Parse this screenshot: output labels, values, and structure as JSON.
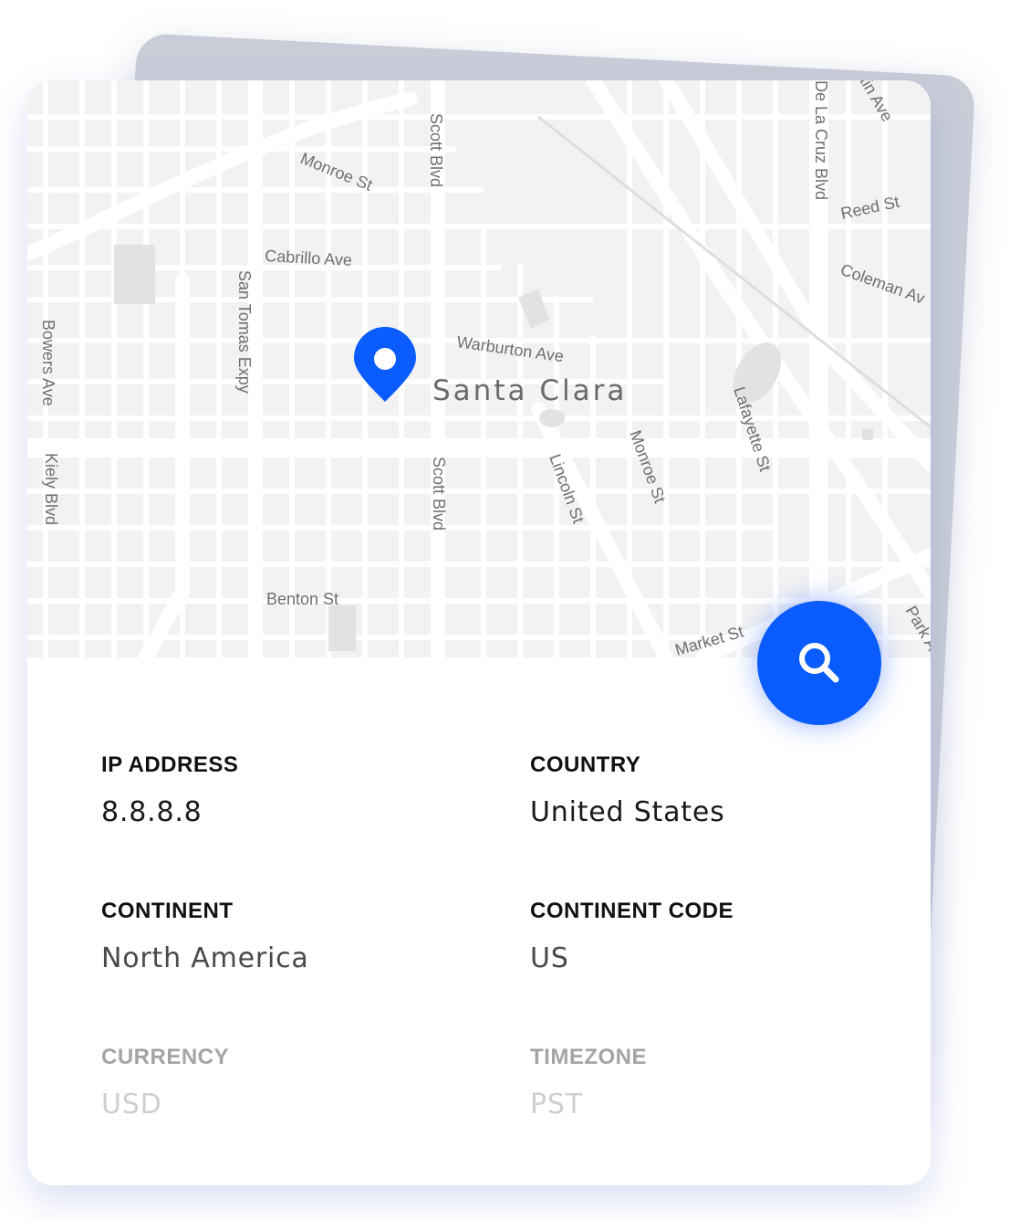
{
  "map": {
    "city": "Santa Clara",
    "roads": {
      "monroe_top": "Monroe St",
      "scott_top": "Scott Blvd",
      "dela_cruz": "De La Cruz Blvd",
      "martin": "tin Ave",
      "reed": "Reed St",
      "cabrillo": "Cabrillo Ave",
      "san_tomas": "San Tomas Expy",
      "coleman": "Coleman Av",
      "warburton": "Warburton Ave",
      "bowers": "Bowers Ave",
      "kiely": "Kiely Blvd",
      "lafayette": "Lafayette St",
      "scott_bottom": "Scott Blvd",
      "lincoln": "Lincoln St",
      "monroe_bottom": "Monroe St",
      "benton": "Benton St",
      "market": "Market St",
      "park": "Park A"
    }
  },
  "fields": {
    "ip_address": {
      "label": "IP ADDRESS",
      "value": "8.8.8.8"
    },
    "country": {
      "label": "COUNTRY",
      "value": "United States"
    },
    "continent": {
      "label": "CONTINENT",
      "value": "North America"
    },
    "continent_code": {
      "label": "CONTINENT CODE",
      "value": "US"
    },
    "currency": {
      "label": "CURRENCY",
      "value": "USD"
    },
    "timezone": {
      "label": "TIMEZONE",
      "value": "PST"
    }
  },
  "colors": {
    "accent": "#0a5cff",
    "map_bg": "#f2f2f2",
    "road": "#ffffff"
  },
  "icons": {
    "pin": "location-pin-icon",
    "search": "search-icon"
  }
}
